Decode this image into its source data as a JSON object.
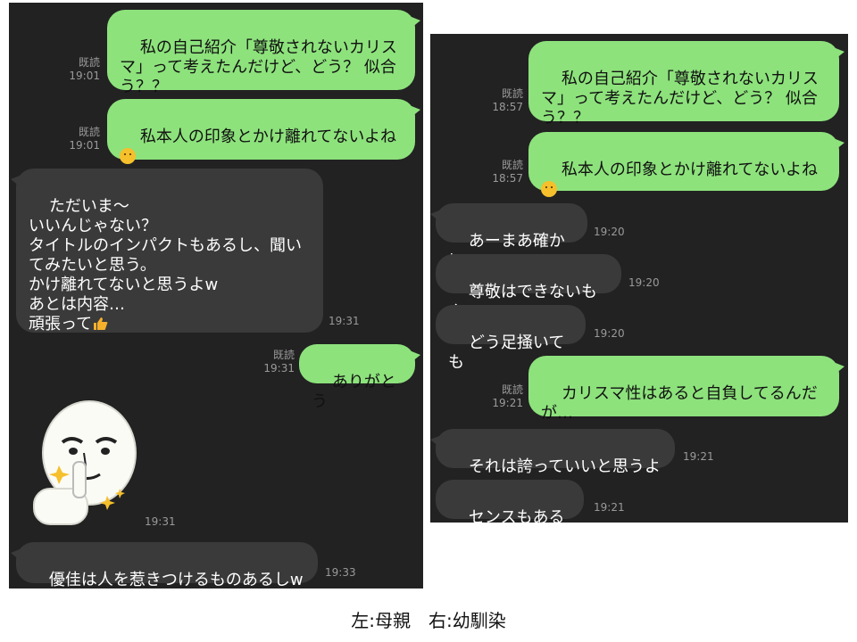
{
  "left": {
    "messages": [
      {
        "type": "sent",
        "text": "私の自己紹介「尊敬されないカリスマ」って考えたんだけど、どう？ 似合う？？",
        "read": "既読",
        "time": "19:01"
      },
      {
        "type": "sent",
        "text": "私本人の印象とかけ離れてないよね",
        "read": "既読",
        "time": "19:01",
        "emoji": "thinking-face"
      },
      {
        "type": "received",
        "text": "ただいま〜\nいいんじゃない？\nタイトルのインパクトもあるし、聞いてみたいと思う。\nかけ離れてないと思うよw\nあとは内容…\n頑張って",
        "time": "19:31",
        "emoji": "thumbs-up"
      },
      {
        "type": "sent",
        "text": "ありがとう",
        "read": "既読",
        "time": "19:31"
      },
      {
        "type": "sticker",
        "sticker": "moon-character-sticker",
        "time": "19:31"
      },
      {
        "type": "received",
        "text": "優佳は人を惹きつけるものあるしw",
        "time": "19:33"
      }
    ]
  },
  "right": {
    "messages": [
      {
        "type": "sent",
        "text": "私の自己紹介「尊敬されないカリスマ」って考えたんだけど、どう？ 似合う？？",
        "read": "既読",
        "time": "18:57"
      },
      {
        "type": "sent",
        "text": "私本人の印象とかけ離れてないよね",
        "read": "既読",
        "time": "18:57",
        "emoji": "thinking-face"
      },
      {
        "type": "received",
        "text": "あーまあ確かに",
        "time": "19:20"
      },
      {
        "type": "received",
        "text": "尊敬はできないもん",
        "time": "19:20"
      },
      {
        "type": "received",
        "text": "どう足掻いても",
        "time": "19:20"
      },
      {
        "type": "sent",
        "text": "カリスマ性はあると自負してるんだが…",
        "read": "既読",
        "time": "19:21"
      },
      {
        "type": "received",
        "text": "それは誇っていいと思うよ",
        "time": "19:21"
      },
      {
        "type": "received",
        "text": "センスもあるし",
        "time": "19:21"
      }
    ]
  },
  "caption": "左:母親　右:幼馴染",
  "colors": {
    "sent_bubble": "#8de27c",
    "received_bubble": "#3a3a3a",
    "background": "#222222"
  }
}
